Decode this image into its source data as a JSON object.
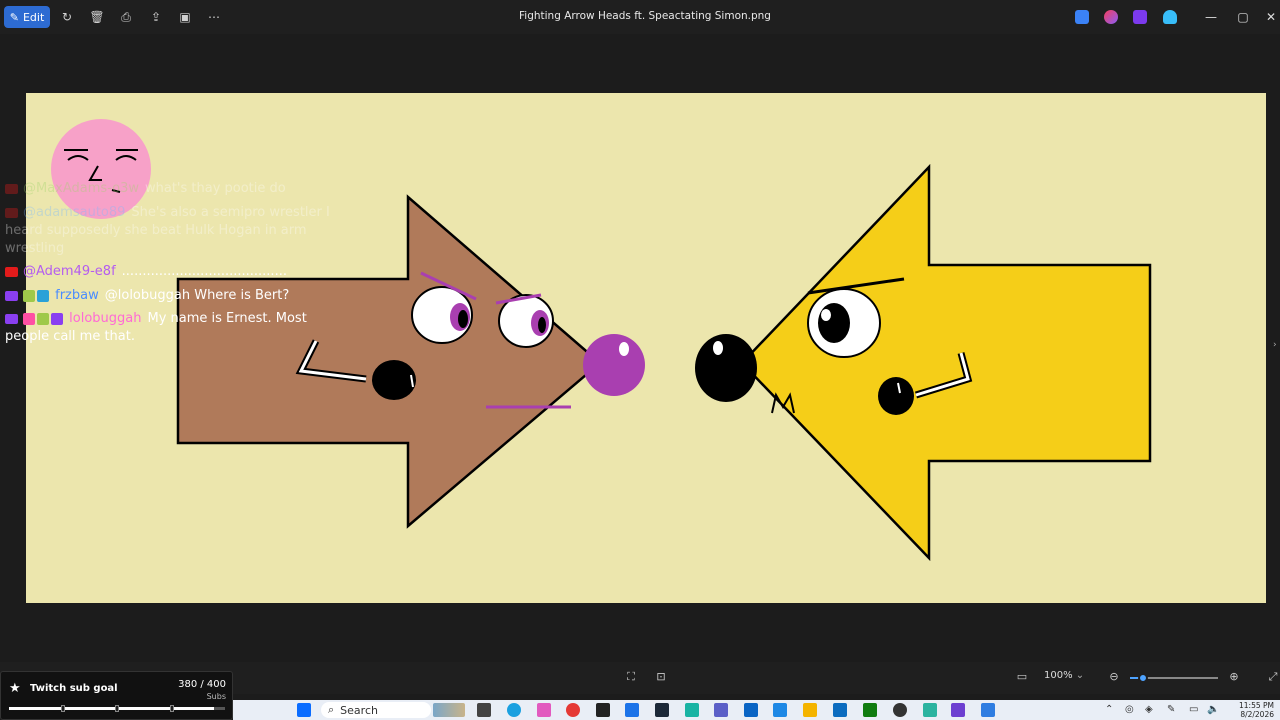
{
  "window": {
    "title": "Fighting Arrow Heads ft. Speactating Simon.png",
    "edit_label": "Edit",
    "zoom": "100%"
  },
  "toolbar_icons": [
    "edit-icon",
    "rotate-icon",
    "delete-icon",
    "print-icon",
    "share-icon",
    "slideshow-icon",
    "more-icon"
  ],
  "chat": {
    "messages": [
      {
        "platform": "youtube",
        "user": "@MaxAdams-o3w",
        "text": "what's thay pootie do",
        "user_color": "#9fd46b",
        "faded": true
      },
      {
        "platform": "youtube",
        "user": "@adamsauto89",
        "text": "She's also a semipro wrestler I",
        "wrap": [
          "heard supposedly she beat Hulk Hogan in arm",
          "wrestling"
        ],
        "user_color": "#7ab9ff",
        "faded": true
      },
      {
        "platform": "youtube",
        "user": "@Adem49-e8f",
        "text": "........................................",
        "user_color": "#b45cf0",
        "faded": false
      },
      {
        "platform": "twitch",
        "user": "frzbaw",
        "text": "@lolobuggah Where is Bert?",
        "user_color": "#4a8cff",
        "faded": false
      },
      {
        "platform": "twitch",
        "user": "lolobuggah",
        "text": "My name is Ernest. Most",
        "wrap": [
          "people call me that."
        ],
        "user_color": "#ff6ad5",
        "faded": false
      }
    ]
  },
  "subgoal": {
    "title": "Twitch sub goal",
    "count": "380 / 400",
    "unit": "Subs",
    "progress": 0.95
  },
  "taskbar": {
    "search_placeholder": "Search",
    "clock_time": "11:55 PM",
    "clock_date": "8/2/2026"
  },
  "colors": {
    "edit_accent": "#2d6bd2",
    "canvas_bg": "#ece6ad",
    "brown_arrow": "#b07a5a",
    "yellow_arrow": "#f5ce18",
    "purple_nose": "#a93fb0"
  },
  "zoom_slider_level": 0.15
}
